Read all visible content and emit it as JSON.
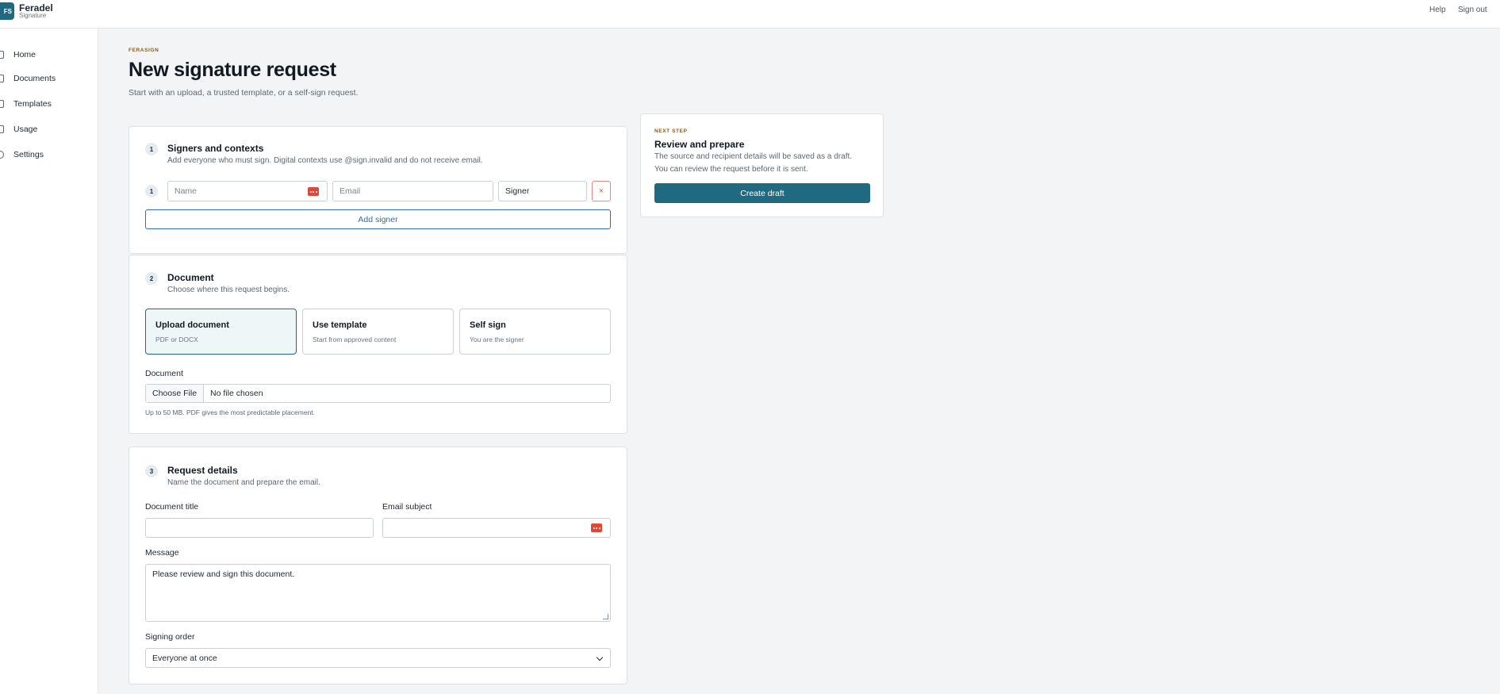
{
  "brand": {
    "logo_text": "FS",
    "name": "Feradel",
    "subtitle": "Signature"
  },
  "topnav": {
    "help": "Help",
    "sign_out": "Sign out"
  },
  "sidebar": {
    "items": [
      {
        "label": "Home",
        "icon": "home-icon"
      },
      {
        "label": "Documents",
        "icon": "document-icon"
      },
      {
        "label": "Templates",
        "icon": "template-icon"
      },
      {
        "label": "Usage",
        "icon": "usage-icon"
      },
      {
        "label": "Settings",
        "icon": "gear-icon"
      }
    ]
  },
  "page": {
    "eyebrow": "FERASIGN",
    "title": "New signature request",
    "subtitle": "Start with an upload, a trusted template, or a self-sign request."
  },
  "signers": {
    "step": "1",
    "title": "Signers and contexts",
    "description": "Add everyone who must sign. Digital contexts use @sign.invalid and do not receive email.",
    "rows": [
      {
        "index": "1",
        "name_placeholder": "Name",
        "email_placeholder": "Email",
        "role": "Signer",
        "remove": "×"
      }
    ],
    "add_label": "Add signer"
  },
  "document": {
    "step": "2",
    "title": "Document",
    "description": "Choose where this request begins.",
    "options": [
      {
        "title": "Upload document",
        "desc": "PDF or DOCX",
        "selected": true
      },
      {
        "title": "Use template",
        "desc": "Start from approved content",
        "selected": false
      },
      {
        "title": "Self sign",
        "desc": "You are the signer",
        "selected": false
      }
    ],
    "file_label": "Document",
    "file_button": "Choose File",
    "file_status": "No file chosen",
    "helper": "Up to 50 MB. PDF gives the most predictable placement."
  },
  "details": {
    "step": "3",
    "title": "Request details",
    "description": "Name the document and prepare the email.",
    "doc_title_label": "Document title",
    "doc_title_value": "",
    "email_subject_label": "Email subject",
    "email_subject_value": "",
    "message_label": "Message",
    "message_value": "Please review and sign this document.",
    "order_label": "Signing order",
    "order_value": "Everyone at once"
  },
  "next_step": {
    "eyebrow": "NEXT STEP",
    "title": "Review and prepare",
    "line1": "The source and recipient details will be saved as a draft.",
    "line2": "You can review the request before it is sent.",
    "button": "Create draft"
  },
  "colors": {
    "accent": "#1f6a80",
    "eyebrow": "#8a5a1c",
    "link": "#2f6fb2",
    "danger": "#d94a3a"
  }
}
